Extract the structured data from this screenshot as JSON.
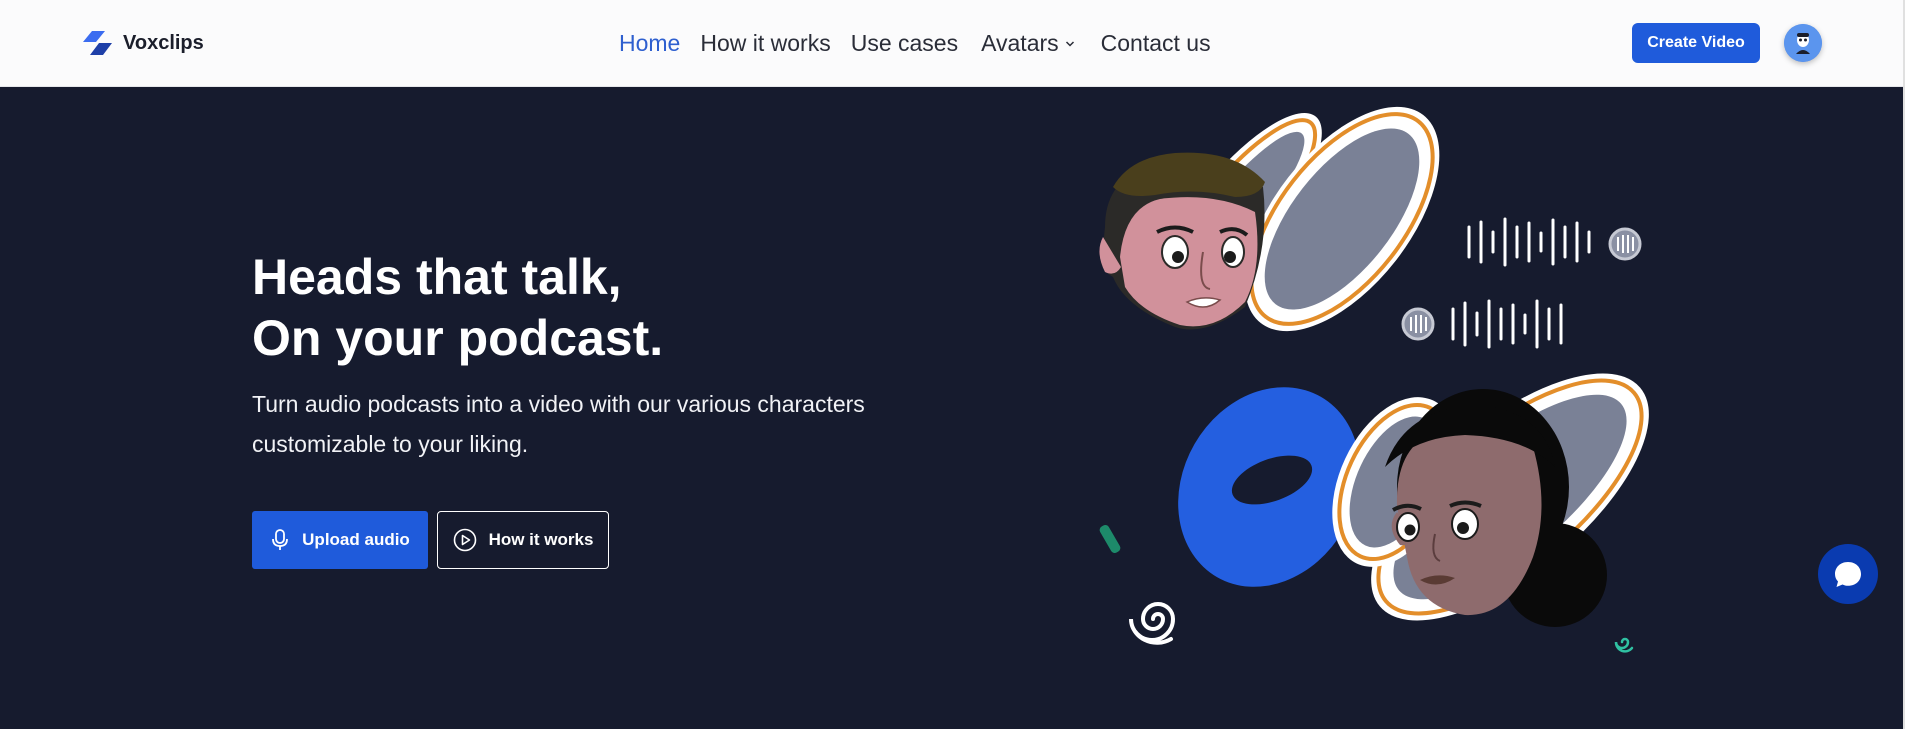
{
  "brand": {
    "name": "Voxclips",
    "logo_icon": "voxclips-logo-icon"
  },
  "nav": {
    "home": "Home",
    "how_it_works": "How it works",
    "use_cases": "Use cases",
    "avatars": "Avatars",
    "contact": "Contact us"
  },
  "header": {
    "create_video": "Create Video",
    "avatar_icon": "user-avatar-icon"
  },
  "hero": {
    "title_line1": "Heads that talk,",
    "title_line2": "On your podcast.",
    "subtitle": "Turn audio podcasts into a video with our various characters customizable to your liking.",
    "upload_label": "Upload audio",
    "how_label": "How it works"
  },
  "colors": {
    "accent": "#1f5bdb",
    "hero_bg": "#161b2e",
    "nav_active": "#2e5fcf",
    "orange_ring": "#e38e2a"
  },
  "chat": {
    "icon": "chat-bubble-icon"
  }
}
